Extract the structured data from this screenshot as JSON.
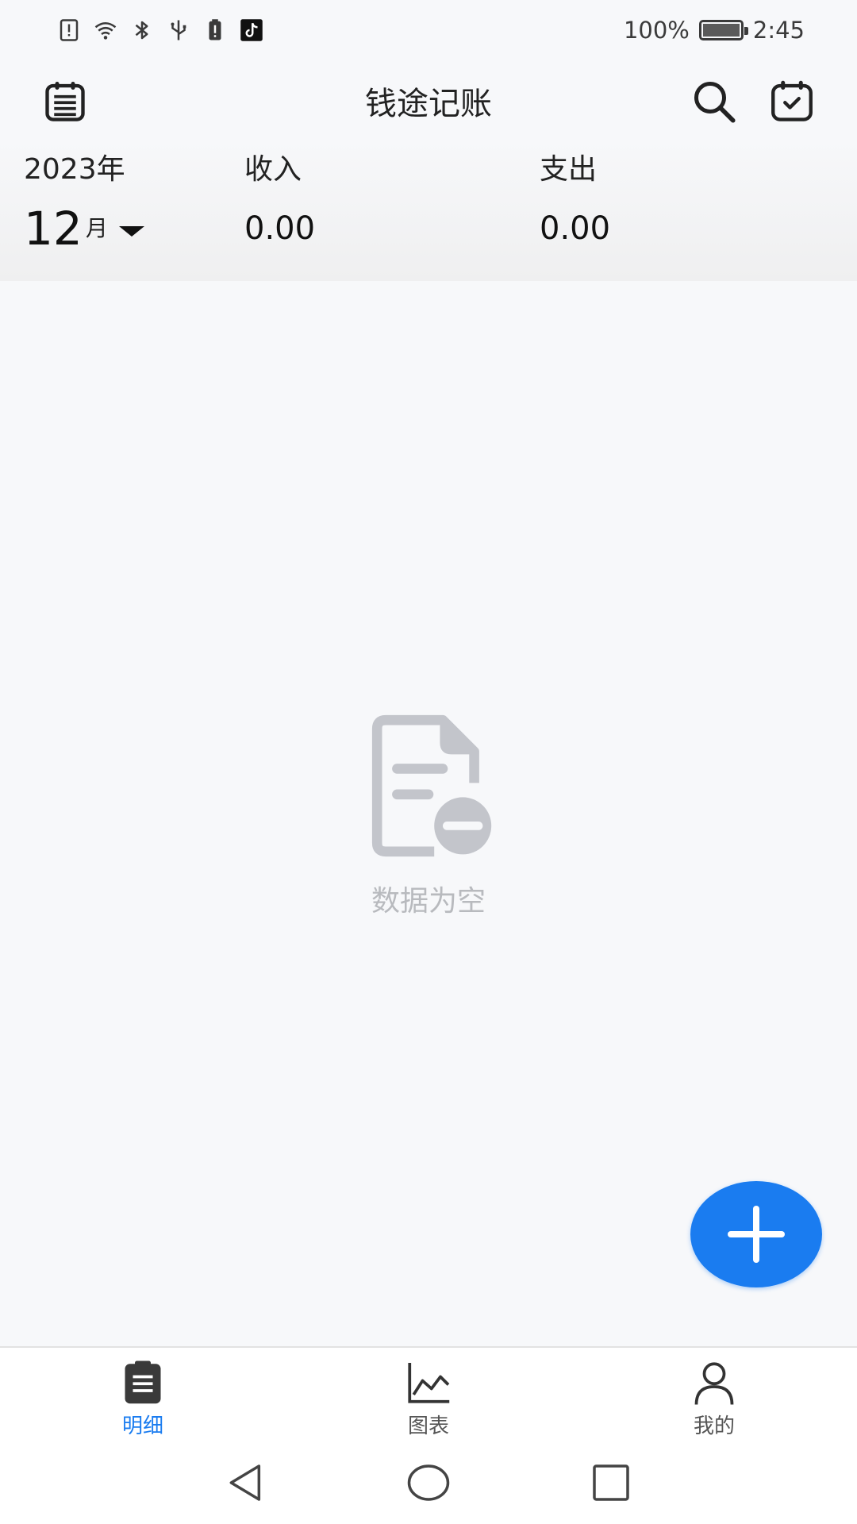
{
  "status_bar": {
    "icons": [
      "sim-alert-icon",
      "wifi-icon",
      "bluetooth-icon",
      "usb-icon",
      "battery-saver-icon",
      "tiktok-icon"
    ],
    "battery_percent": "100%",
    "time": "2:45"
  },
  "header": {
    "title": "钱途记账",
    "left_icon": "ledger-list-icon",
    "right_icons": [
      "search-icon",
      "calendar-check-icon"
    ]
  },
  "summary": {
    "year": "2023年",
    "month_num": "12",
    "month_unit": "月",
    "income_label": "收入",
    "income_value": "0.00",
    "expense_label": "支出",
    "expense_value": "0.00"
  },
  "empty_state": {
    "icon": "empty-document-icon",
    "text": "数据为空"
  },
  "fab": {
    "icon": "plus-icon"
  },
  "bottom_nav": {
    "items": [
      {
        "label": "明细",
        "icon": "details-icon",
        "active": true
      },
      {
        "label": "图表",
        "icon": "chart-icon",
        "active": false
      },
      {
        "label": "我的",
        "icon": "profile-icon",
        "active": false
      }
    ]
  },
  "system_nav": {
    "icons": [
      "back-icon",
      "home-icon",
      "recents-icon"
    ]
  },
  "colors": {
    "accent": "#1a7cf0",
    "background": "#f7f8fa",
    "empty_text": "#b8babe"
  }
}
